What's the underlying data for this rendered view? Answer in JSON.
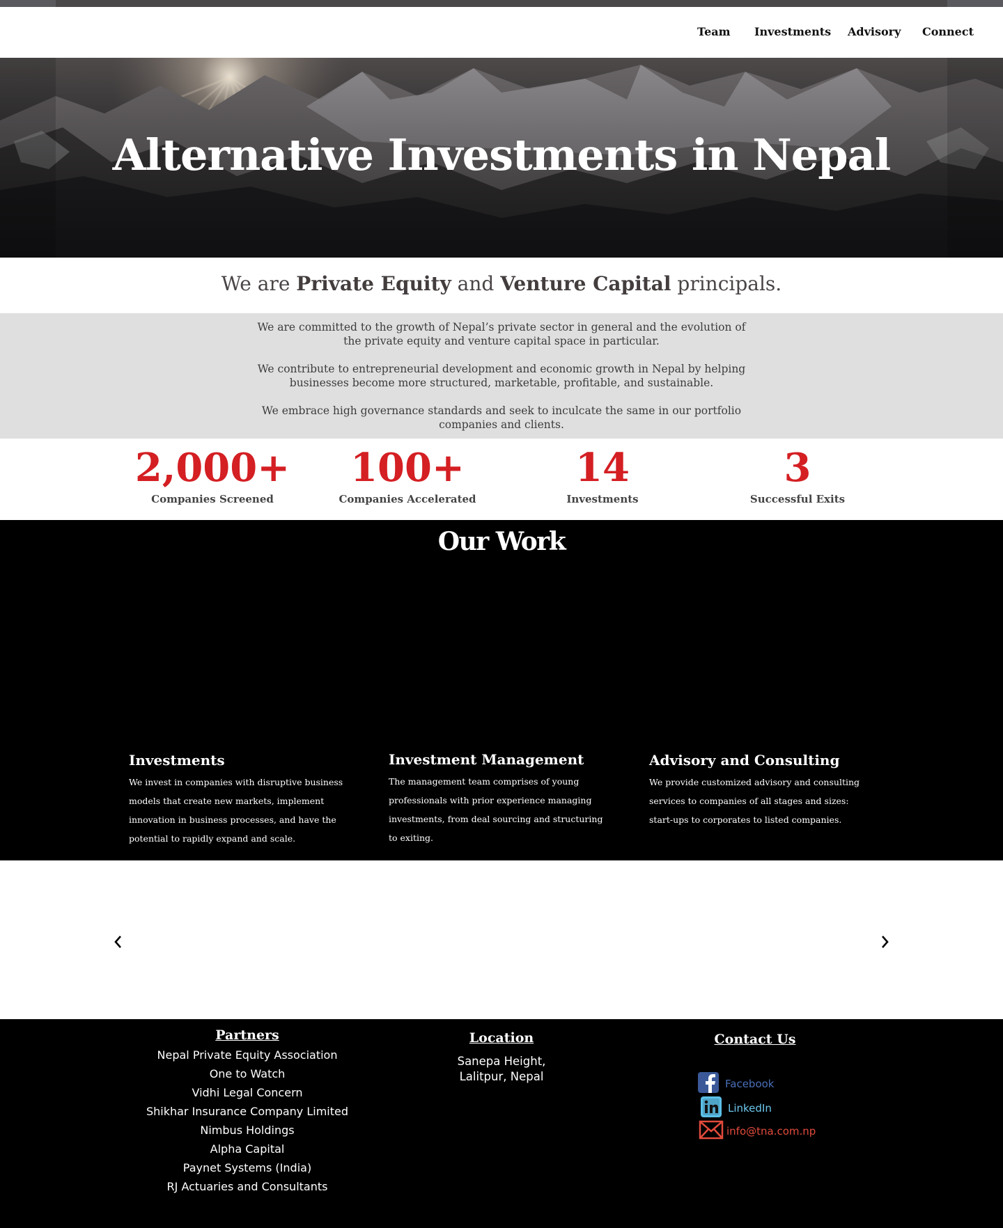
{
  "nav": {
    "items": [
      "Team",
      "Investments",
      "Advisory",
      "Connect"
    ]
  },
  "hero": {
    "title": "Alternative Investments in Nepal"
  },
  "tagline": {
    "prefix": "We are ",
    "bold1": "Private Equity",
    "mid": " and ",
    "bold2": "Venture Capital",
    "suffix": " principals."
  },
  "mission": {
    "p1": "We are committed to the growth of Nepal’s private sector in general and the evolution of the private equity and venture capital space in particular.",
    "p2": "We contribute to entrepreneurial development and economic growth in Nepal by helping businesses become more structured, marketable, profitable, and sustainable.",
    "p3": "We embrace high governance standards and seek to inculcate the same in our portfolio companies and clients."
  },
  "stats": [
    {
      "value": "2,000+",
      "label": "Companies Screened"
    },
    {
      "value": "100+",
      "label": "Companies Accelerated"
    },
    {
      "value": "14",
      "label": "Investments"
    },
    {
      "value": "3",
      "label": "Successful Exits"
    }
  ],
  "work": {
    "title": "Our Work",
    "columns": [
      {
        "title": "Investments",
        "text": "We invest in companies with disruptive business models that create new markets, implement innovation in business processes, and have the potential to rapidly expand and scale."
      },
      {
        "title": "Investment Management",
        "text": "The management team comprises of young professionals with prior experience managing investments, from deal sourcing and structuring to exiting."
      },
      {
        "title": "Advisory and Consulting",
        "text": "We provide customized advisory and consulting services to companies of all stages and sizes: start-ups to corporates to listed companies."
      }
    ]
  },
  "footer": {
    "partners": {
      "title": "Partners",
      "items": [
        "Nepal Private Equity Association",
        "One to Watch",
        "Vidhi Legal Concern",
        "Shikhar Insurance Company Limited",
        "Nimbus Holdings",
        "Alpha Capital",
        "Paynet Systems (India)",
        "RJ Actuaries and Consultants"
      ]
    },
    "location": {
      "title": "Location",
      "line1": "Sanepa Height,",
      "line2": "Lalitpur, Nepal"
    },
    "contact": {
      "title": "Contact Us",
      "facebook": "Facebook",
      "linkedin": "LinkedIn",
      "email": "info@tna.com.np"
    }
  },
  "colors": {
    "accent": "#d41f23",
    "facebook": "#3b5998",
    "linkedin": "#5bc0e8",
    "email": "#e24b3c"
  }
}
